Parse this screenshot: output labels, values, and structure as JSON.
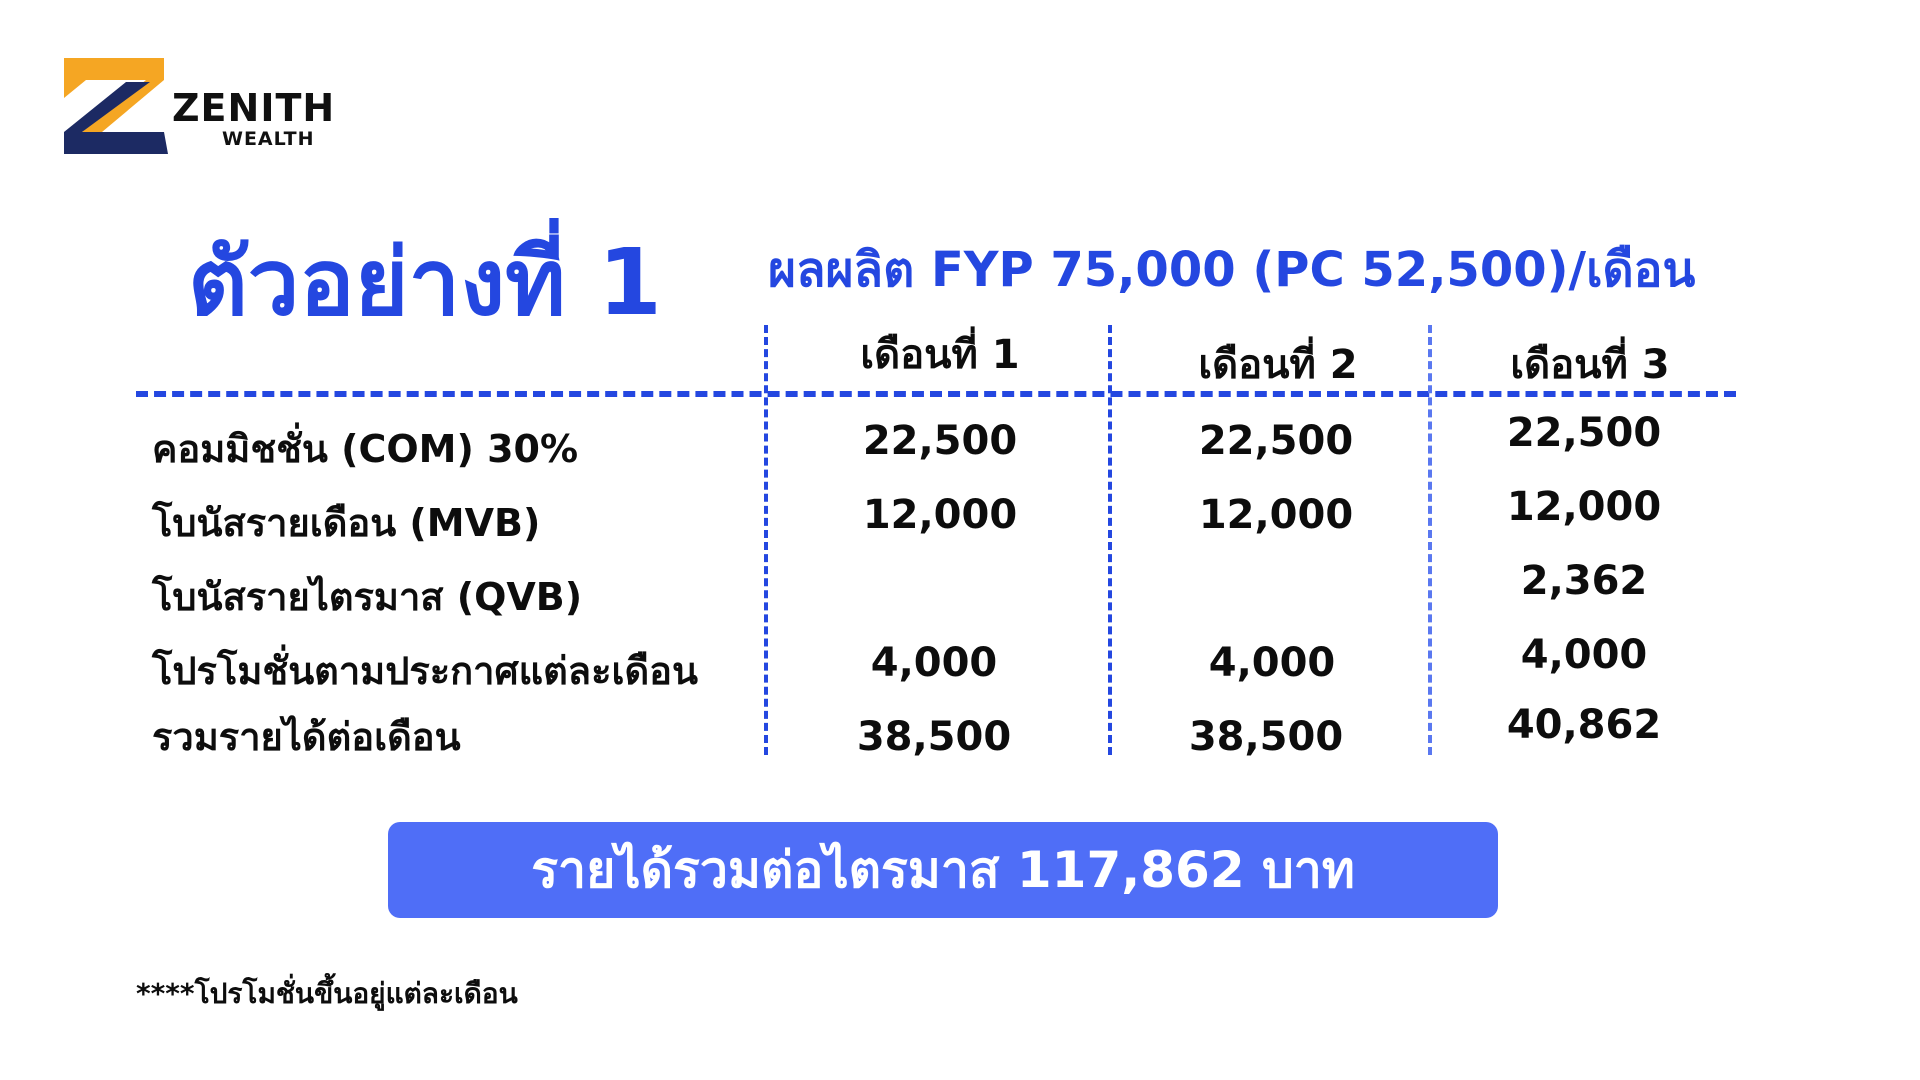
{
  "brand": {
    "name": "ZENITH",
    "sub": "WEALTH"
  },
  "title": "ตัวอย่างที่ 1",
  "subtitle": "ผลผลิต FYP 75,000 (PC 52,500)/เดือน",
  "columns": [
    "เดือนที่ 1",
    "เดือนที่ 2",
    "เดือนที่ 3"
  ],
  "rows": [
    {
      "label": "คอมมิชชั่น (COM) 30%",
      "values": [
        "22,500",
        "22,500",
        "22,500"
      ]
    },
    {
      "label": "โบนัสรายเดือน (MVB)",
      "values": [
        "12,000",
        "12,000",
        "12,000"
      ]
    },
    {
      "label": "โบนัสรายไตรมาส (QVB)",
      "values": [
        "",
        "",
        "2,362"
      ]
    },
    {
      "label": "โปรโมชั่นตามประกาศแต่ละเดือน",
      "values": [
        "4,000",
        "4,000",
        "4,000"
      ]
    },
    {
      "label": "รวมรายได้ต่อเดือน",
      "values": [
        "38,500",
        "38,500",
        "40,862"
      ]
    }
  ],
  "total": "รายได้รวมต่อไตรมาส  117,862  บาท",
  "footnote": "****โปรโมชั่นขึ้นอยู่แต่ละเดือน",
  "colors": {
    "accent": "#2447e0",
    "button": "#4f6ef7",
    "logo_orange": "#f5a623",
    "logo_navy": "#1c2a63"
  }
}
